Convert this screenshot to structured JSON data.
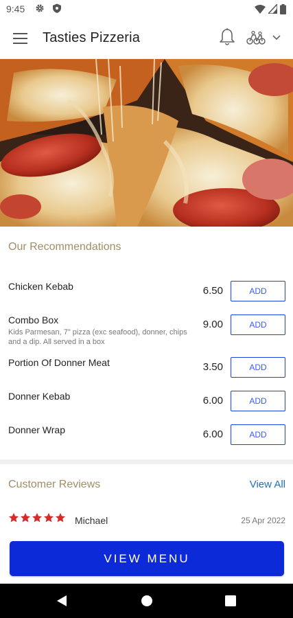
{
  "status_bar": {
    "time": "9:45",
    "left_icons": [
      "gear-icon",
      "shield-icon"
    ],
    "right_icons": [
      "wifi-icon",
      "signal-icon",
      "battery-icon"
    ]
  },
  "app_bar": {
    "title": "Tasties Pizzeria",
    "icons": [
      "menu-icon",
      "bell-icon",
      "delivery-bikes-icon",
      "chevron-down-icon"
    ]
  },
  "hero": {
    "alt": "pizza-photo"
  },
  "recommendations": {
    "title": "Our Recommendations",
    "add_label": "ADD",
    "items": [
      {
        "name": "Chicken Kebab",
        "description": "",
        "price": "6.50"
      },
      {
        "name": "Combo Box",
        "description": "Kids Parmesan, 7\" pizza (exc seafood), donner, chips and a dip. All served in a box",
        "price": "9.00"
      },
      {
        "name": "Portion Of Donner Meat",
        "description": "",
        "price": "3.50"
      },
      {
        "name": "Donner Kebab",
        "description": "",
        "price": "6.00"
      },
      {
        "name": "Donner Wrap",
        "description": "",
        "price": "6.00"
      }
    ]
  },
  "reviews": {
    "title": "Customer Reviews",
    "view_all_label": "View All",
    "items": [
      {
        "rating": 5,
        "reviewer": "Michael",
        "date": "25 Apr 2022"
      }
    ]
  },
  "view_menu_label": "VIEW MENU",
  "colors": {
    "accent_gold": "#a08e64",
    "primary_blue": "#0d2ad8",
    "link_blue": "#1e6fb8",
    "star_red": "#d52b2b"
  },
  "nav_bar": {
    "icons": [
      "back-icon",
      "home-icon",
      "recent-apps-icon"
    ]
  }
}
